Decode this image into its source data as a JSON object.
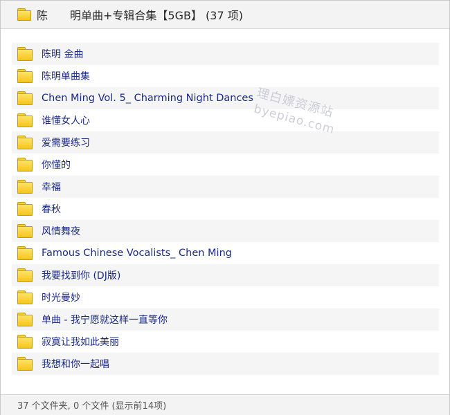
{
  "header": {
    "title": "陈　　明单曲+专辑合集【5GB】 (37 项)"
  },
  "items": [
    {
      "label": "陈明 金曲"
    },
    {
      "label": "陈明单曲集"
    },
    {
      "label": "Chen Ming Vol. 5_ Charming Night Dances"
    },
    {
      "label": "谁懂女人心"
    },
    {
      "label": "爱需要练习"
    },
    {
      "label": "你懂的"
    },
    {
      "label": "幸福"
    },
    {
      "label": "春秋"
    },
    {
      "label": "风情舞夜"
    },
    {
      "label": "Famous Chinese Vocalists_ Chen Ming"
    },
    {
      "label": "我要找到你 (DJ版)"
    },
    {
      "label": "时光曼妙"
    },
    {
      "label": "单曲 - 我宁愿就这样一直等你"
    },
    {
      "label": "寂寞让我如此美丽"
    },
    {
      "label": "我想和你一起唱"
    }
  ],
  "watermark": {
    "line1": "理白嫖资源站",
    "line2": "byepiao.com"
  },
  "status": {
    "text": "37 个文件夹, 0 个文件 (显示前14项)"
  },
  "colors": {
    "label_text": "#1b2a84",
    "folder_fill": "#f6c419",
    "stripe": "#f5f5f5"
  },
  "icons": {
    "folder": "folder-icon"
  }
}
